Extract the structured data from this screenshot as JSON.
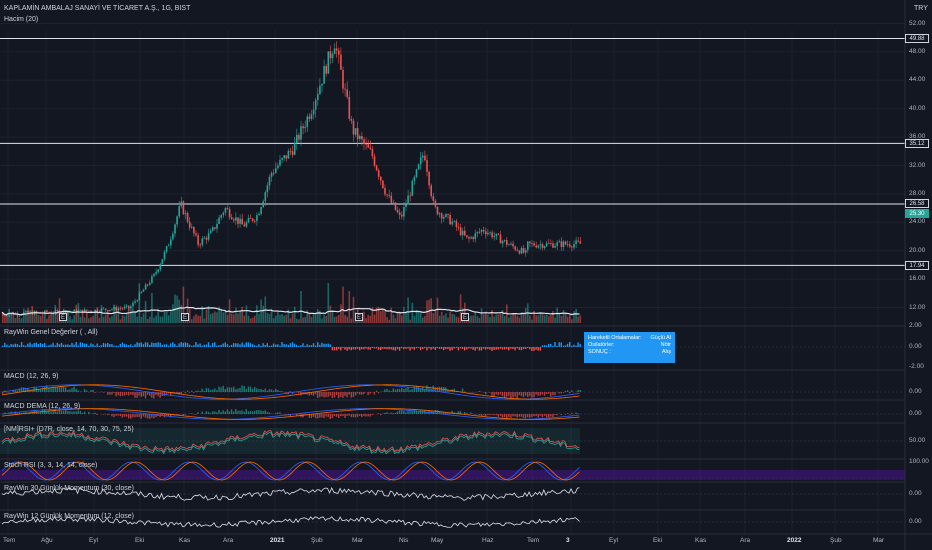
{
  "header": {
    "title": "KAPLAMİN AMBALAJ SANAYİ VE TİCARET A.Ş., 1G, BIST",
    "volume_label": "Hacim (20)",
    "currency": "TRY"
  },
  "price_axis": {
    "ticks": [
      "52.00",
      "48.00",
      "44.00",
      "40.00",
      "36.00",
      "32.00",
      "28.00",
      "24.00",
      "20.00",
      "16.00",
      "12.00"
    ],
    "hlines": [
      "49.88",
      "35.12",
      "26.58",
      "17.94"
    ],
    "last_price": "25.30"
  },
  "earnings_badges": [
    "E",
    "E",
    "E",
    "E"
  ],
  "indicators": [
    {
      "key": "raywin",
      "title": "RayWin Genel Değerler ( , All)",
      "ticks": [
        "2.00",
        "0.00",
        "-2.00"
      ]
    },
    {
      "key": "macd",
      "title": "MACD (12, 26, 9)",
      "ticks": [
        "0.00"
      ]
    },
    {
      "key": "macd_dema",
      "title": "MACD DEMA (12, 26, 9)",
      "ticks": [
        "0.00"
      ]
    },
    {
      "key": "rsi",
      "title": "[NM]RSI+ (D7R, close, 14, 70, 30, 75, 25)",
      "ticks": [
        "50.00"
      ]
    },
    {
      "key": "stoch",
      "title": "Stoch RSI (3, 3, 14, 14, close)",
      "ticks": [
        "100.00"
      ]
    },
    {
      "key": "mom30",
      "title": "RayWin 30 Günlük Momentum (30, close)",
      "ticks": [
        "0.00"
      ]
    },
    {
      "key": "mom12",
      "title": "RayWin 12 Günlük Momentum (12, close)",
      "ticks": [
        "0.00"
      ]
    }
  ],
  "infobox": {
    "row1_label": "Hareketli Ortalamalar:",
    "row1_value": "Güçlü Al",
    "row2_label": "Osilatörler:",
    "row2_value": "Nötr",
    "row3_label": "SONUÇ :",
    "row3_value": "Alış"
  },
  "time_axis": [
    "Tem",
    "Ağu",
    "Eyl",
    "Eki",
    "Kas",
    "Ara",
    "2021",
    "Şub",
    "Mar",
    "Nis",
    "May",
    "Haz",
    "Tem",
    "3",
    "Eyl",
    "Eki",
    "Kas",
    "Ara",
    "2022",
    "Şub",
    "Mar"
  ],
  "colors": {
    "up": "#26a69a",
    "down": "#ef5350",
    "bg": "#131722",
    "accent": "#2196f3"
  },
  "chart_data": {
    "type": "candlestick",
    "title": "KAPLAMİN AMBALAJ SANAYİ VE TİCARET A.Ş., 1G, BIST",
    "currency": "TRY",
    "ylim": [
      10,
      53
    ],
    "x": [
      "Tem",
      "Ağu",
      "Eyl",
      "Eki",
      "Kas",
      "Ara",
      "2021",
      "Şub",
      "Mar",
      "Nis",
      "May",
      "Haz",
      "Tem",
      "3"
    ],
    "close_path": [
      [
        "Tem",
        11.2
      ],
      [
        "Ağu",
        11.5
      ],
      [
        "Eyl",
        12.0
      ],
      [
        "Eki",
        16.5
      ],
      [
        "Eki",
        20.5
      ],
      [
        "Eki",
        26.5
      ],
      [
        "Kas",
        21.0
      ],
      [
        "Kas",
        22.5
      ],
      [
        "Kas",
        26.0
      ],
      [
        "Ara",
        23.5
      ],
      [
        "Ara",
        25.0
      ],
      [
        "Ara",
        31.0
      ],
      [
        "2021",
        34.5
      ],
      [
        "2021",
        40.0
      ],
      [
        "Şub",
        49.5
      ],
      [
        "Şub",
        37.0
      ],
      [
        "Mar",
        33.5
      ],
      [
        "Mar",
        28.0
      ],
      [
        "Mar",
        24.5
      ],
      [
        "Nis",
        30.0
      ],
      [
        "Nis",
        34.0
      ],
      [
        "Nis",
        26.0
      ],
      [
        "May",
        24.0
      ],
      [
        "May",
        21.5
      ],
      [
        "May",
        23.0
      ],
      [
        "Haz",
        21.0
      ],
      [
        "Haz",
        19.5
      ],
      [
        "Tem",
        18.5
      ],
      [
        "Tem",
        19.8
      ],
      [
        "3",
        21.0
      ],
      [
        "3",
        25.3
      ]
    ],
    "horizontal_levels": [
      49.88,
      35.12,
      26.58,
      17.94
    ],
    "last_price": 25.3
  }
}
